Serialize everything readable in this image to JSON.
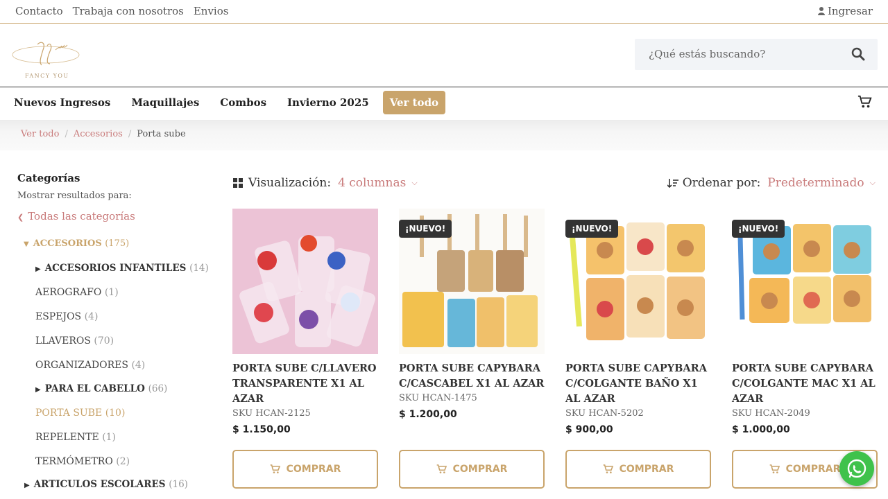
{
  "topbar": {
    "links": [
      "Contacto",
      "Trabaja con nosotros",
      "Envios"
    ],
    "login_label": "Ingresar"
  },
  "header": {
    "logo_text": "FANCY YOU",
    "search_placeholder": "¿Qué estás buscando?"
  },
  "nav": {
    "items": [
      "Nuevos Ingresos",
      "Maquillajes",
      "Combos",
      "Invierno 2025"
    ],
    "active_item": "Ver todo"
  },
  "breadcrumb": {
    "items": [
      "Ver todo",
      "Accesorios"
    ],
    "current": "Porta sube"
  },
  "sidebar": {
    "title": "Categorías",
    "subtitle": "Mostrar resultados para:",
    "all_link": "Todas las categorías",
    "categories": [
      {
        "label": "ACCESORIOS",
        "count": "(175)"
      },
      {
        "label": "ACCESORIOS INFANTILES",
        "count": "(14)"
      },
      {
        "label": "AEROGRAFO",
        "count": "(1)"
      },
      {
        "label": "ESPEJOS",
        "count": "(4)"
      },
      {
        "label": "LLAVEROS",
        "count": "(70)"
      },
      {
        "label": "ORGANIZADORES",
        "count": "(4)"
      },
      {
        "label": "PARA EL CABELLO",
        "count": "(66)"
      },
      {
        "label": "PORTA SUBE",
        "count": "(10)"
      },
      {
        "label": "REPELENTE",
        "count": "(1)"
      },
      {
        "label": "TERMÓMETRO",
        "count": "(2)"
      },
      {
        "label": "ARTICULOS ESCOLARES",
        "count": "(16)"
      }
    ]
  },
  "toolbar": {
    "view_label": "Visualización:",
    "view_value": "4 columnas",
    "sort_label": "Ordenar por:",
    "sort_value": "Predeterminado"
  },
  "products": [
    {
      "name": "PORTA SUBE C/LLAVERO TRANSPARENTE X1 AL AZAR",
      "sku": "SKU HCAN-2125",
      "price": "$  1.150,00",
      "badge": "",
      "button": "COMPRAR"
    },
    {
      "name": "PORTA SUBE CAPYBARA C/CASCABEL X1 AL AZAR",
      "sku": "SKU HCAN-1475",
      "price": "$  1.200,00",
      "badge": "¡NUEVO!",
      "button": "COMPRAR"
    },
    {
      "name": "PORTA SUBE CAPYBARA C/COLGANTE BAÑO X1 AL AZAR",
      "sku": "SKU HCAN-5202",
      "price": "$  900,00",
      "badge": "¡NUEVO!",
      "button": "COMPRAR"
    },
    {
      "name": "PORTA SUBE CAPYBARA C/COLGANTE MAC X1 AL AZAR",
      "sku": "SKU HCAN-2049",
      "price": "$  1.000,00",
      "badge": "¡NUEVO!",
      "button": "COMPRAR"
    }
  ],
  "colors": {
    "accent_gold": "#c9a46b",
    "link_rose": "#c97b7b",
    "whatsapp_green": "#3fc24b"
  },
  "icons": [
    "user-icon",
    "search-icon",
    "cart-icon",
    "grid-icon",
    "sort-icon",
    "cart-small-icon",
    "whatsapp-icon"
  ]
}
